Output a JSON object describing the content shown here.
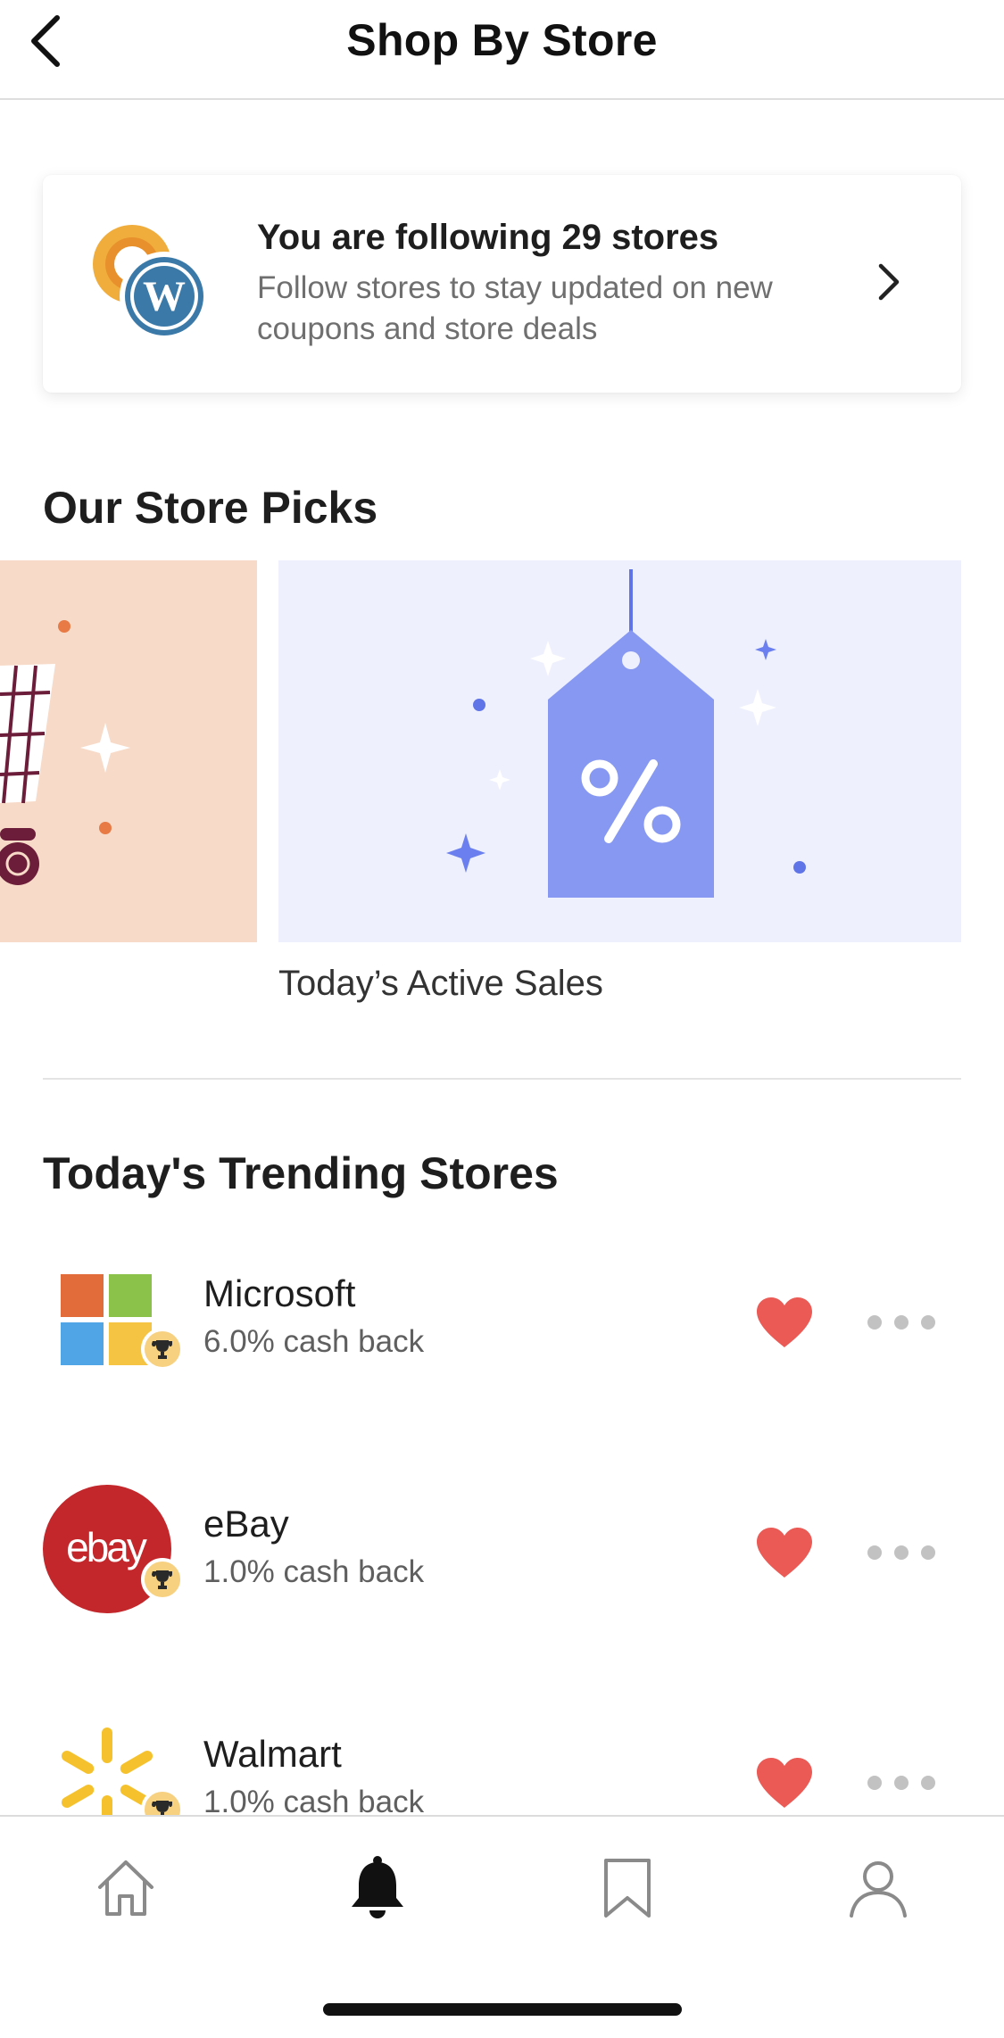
{
  "header": {
    "title": "Shop By Store"
  },
  "follow_card": {
    "title": "You are following 29 stores",
    "subtitle": "Follow stores to stay updated on new coupons and store deals"
  },
  "store_picks": {
    "heading": "Our Store Picks",
    "cards": [
      {
        "label": ""
      },
      {
        "label": "Today’s Active Sales"
      }
    ]
  },
  "trending": {
    "heading": "Today's Trending Stores",
    "stores": [
      {
        "name": "Microsoft",
        "cashback": "6.0% cash back",
        "logo_icon": "microsoft-logo",
        "favorited": true
      },
      {
        "name": "eBay",
        "cashback": "1.0% cash back",
        "logo_icon": "ebay-logo",
        "logo_text": "ebay",
        "favorited": true
      },
      {
        "name": "Walmart",
        "cashback": "1.0% cash back",
        "logo_icon": "walmart-spark-logo",
        "favorited": true
      }
    ]
  },
  "tabbar": {
    "tabs": [
      {
        "icon": "home-icon",
        "active": false
      },
      {
        "icon": "bell-icon",
        "active": true
      },
      {
        "icon": "bookmark-icon",
        "active": false
      },
      {
        "icon": "profile-icon",
        "active": false
      }
    ]
  },
  "colors": {
    "heart": "#eb5a55",
    "ebay_red": "#c3272b",
    "sales_card_bg": "#eef0fd",
    "sales_tag": "#8798f2",
    "left_card_bg": "#f7dac8",
    "badge": "#f7d080"
  }
}
